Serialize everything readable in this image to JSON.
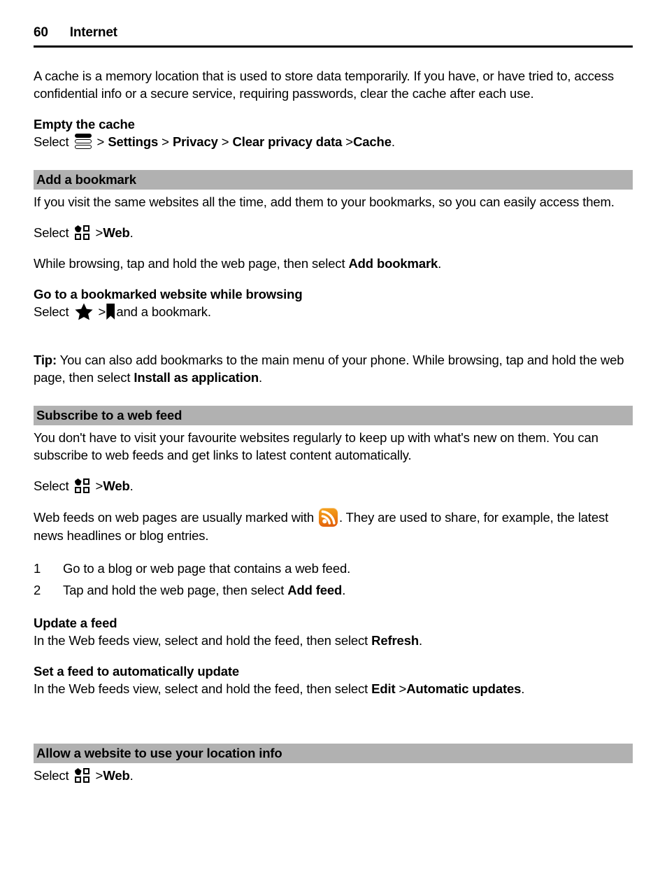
{
  "header": {
    "page_number": "60",
    "title": "Internet"
  },
  "colors": {
    "section_bar_bg": "#b1b1b1",
    "rss_orange": "#ef8b13",
    "text": "#000000"
  },
  "icons": {
    "menu": "menu-bars-icon",
    "grid": "app-grid-icon",
    "star": "star-icon",
    "bookmark": "bookmark-ribbon-icon",
    "rss": "rss-feed-icon"
  },
  "intro": {
    "paragraph": "A cache is a memory location that is used to store data temporarily. If you have, or have tried to, access confidential info or a secure service, requiring passwords, clear the cache after each use."
  },
  "empty_cache": {
    "heading": "Empty the cache",
    "select_word": "Select",
    "gt1": ">",
    "item1": "Settings",
    "gt2": ">",
    "item2": "Privacy",
    "gt3": ">",
    "item3": "Clear privacy data",
    "gt4": ">",
    "item4": "Cache",
    "period": "."
  },
  "add_bookmark": {
    "section_title": "Add a bookmark",
    "paragraph": "If you visit the same websites all the time, add them to your bookmarks, so you can easily access them.",
    "select_word": "Select",
    "gt": ">",
    "web": "Web",
    "period": ".",
    "browsing_pre": "While browsing, tap and hold the web page, then select ",
    "browsing_bold": "Add bookmark",
    "browsing_post": "."
  },
  "goto_bookmark": {
    "heading": "Go to a bookmarked website while browsing",
    "select_word": "Select",
    "gt": ">",
    "tail": "and a bookmark."
  },
  "tip": {
    "label": "Tip:",
    "pre": " You can also add bookmarks to the main menu of your phone. While browsing, tap and hold the web page, then select ",
    "bold": "Install as application",
    "post": "."
  },
  "subscribe_feed": {
    "section_title": "Subscribe to a web feed",
    "paragraph": "You don't have to visit your favourite websites regularly to keep up with what's new on them. You can subscribe to web feeds and get links to latest content automatically.",
    "select_word": "Select",
    "gt": ">",
    "web": "Web",
    "period": ".",
    "marked_pre": "Web feeds on web pages are usually marked with ",
    "marked_post": ". They are used to share, for example, the latest news headlines or blog entries.",
    "steps": [
      {
        "num": "1",
        "text": "Go to a blog or web page that contains a web feed.",
        "bold": "",
        "text_post": ""
      },
      {
        "num": "2",
        "text": "Tap and hold the web page, then select ",
        "bold": "Add feed",
        "text_post": "."
      }
    ]
  },
  "update_feed": {
    "heading": "Update a feed",
    "pre": "In the Web feeds view, select and hold the feed, then select ",
    "bold": "Refresh",
    "post": "."
  },
  "auto_update_feed": {
    "heading": "Set a feed to automatically update",
    "pre": "In the Web feeds view, select and hold the feed, then select ",
    "bold1": "Edit",
    "gt": ">",
    "bold2": "Automatic updates",
    "post": "."
  },
  "location_info": {
    "section_title": "Allow a website to use your location info",
    "select_word": "Select",
    "gt": ">",
    "web": "Web",
    "period": "."
  }
}
